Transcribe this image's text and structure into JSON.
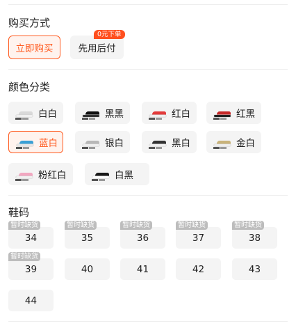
{
  "purchase": {
    "title": "购买方式",
    "options": [
      {
        "label": "立即购买",
        "selected": true
      },
      {
        "label": "先用后付",
        "badge": "0元下单",
        "selected": false
      }
    ]
  },
  "colors": {
    "title": "颜色分类",
    "options": [
      {
        "label": "白白",
        "thumb": "white-shoe-icon",
        "upper": "#d9d9d9",
        "sole": "#f0f0f0",
        "selected": false
      },
      {
        "label": "黑黑",
        "thumb": "black-shoe-icon",
        "upper": "#111111",
        "sole": "#333333",
        "selected": false
      },
      {
        "label": "红白",
        "thumb": "red-white-shoe-icon",
        "upper": "#e23b3b",
        "sole": "#eeeeee",
        "selected": false
      },
      {
        "label": "红黑",
        "thumb": "red-black-shoe-icon",
        "upper": "#c62828",
        "sole": "#222222",
        "selected": false
      },
      {
        "label": "蓝白",
        "thumb": "blue-white-shoe-icon",
        "upper": "#3aa0d6",
        "sole": "#e6e6e6",
        "selected": true
      },
      {
        "label": "银白",
        "thumb": "silver-white-shoe-icon",
        "upper": "#b8b8b8",
        "sole": "#efefef",
        "selected": false
      },
      {
        "label": "黑白",
        "thumb": "black-white-shoe-icon",
        "upper": "#333333",
        "sole": "#f0f0f0",
        "selected": false
      },
      {
        "label": "金白",
        "thumb": "gold-white-shoe-icon",
        "upper": "#c9b37a",
        "sole": "#eeeeee",
        "selected": false
      },
      {
        "label": "粉红白",
        "thumb": "pink-white-shoe-icon",
        "upper": "#f2a7c0",
        "sole": "#f0f0f0",
        "selected": false
      },
      {
        "label": "白黑",
        "thumb": "white-black-shoe-icon",
        "upper": "#1a1a1a",
        "sole": "#ffffff",
        "selected": false
      }
    ]
  },
  "sizes": {
    "title": "鞋码",
    "options": [
      {
        "label": "34",
        "status": "暂时缺货"
      },
      {
        "label": "35",
        "status": "暂时缺货"
      },
      {
        "label": "36",
        "status": "暂时缺货"
      },
      {
        "label": "37",
        "status": "暂时缺货"
      },
      {
        "label": "38",
        "status": "暂时缺货"
      },
      {
        "label": "39",
        "status": "暂时缺货"
      },
      {
        "label": "40"
      },
      {
        "label": "41"
      },
      {
        "label": "42"
      },
      {
        "label": "43"
      },
      {
        "label": "44"
      }
    ]
  },
  "theme": {
    "accent": "#ff5a1f",
    "chip_bg": "#f4f4f4",
    "oos_badge": "#bdbdbd"
  }
}
